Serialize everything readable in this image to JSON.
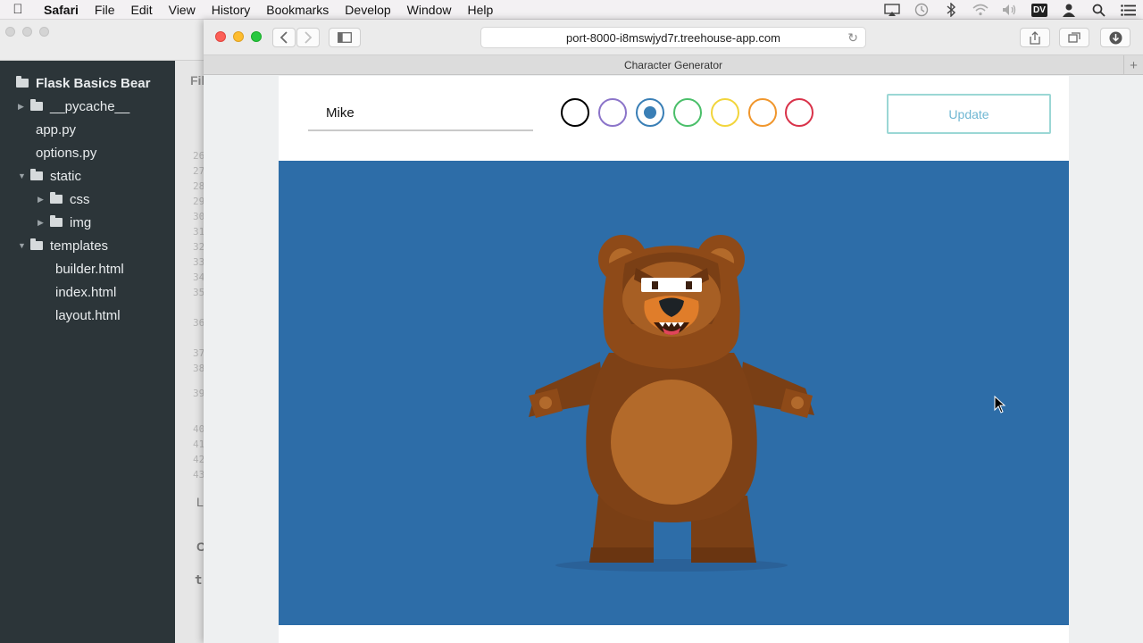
{
  "menubar": {
    "app": "Safari",
    "items": [
      "File",
      "Edit",
      "View",
      "History",
      "Bookmarks",
      "Develop",
      "Window",
      "Help"
    ],
    "status_badge": "DV"
  },
  "sidebar": {
    "project": "Flask Basics Bear",
    "items": [
      {
        "label": "__pycache__",
        "type": "folder"
      },
      {
        "label": "app.py",
        "type": "file"
      },
      {
        "label": "options.py",
        "type": "file"
      },
      {
        "label": "static",
        "type": "folder"
      },
      {
        "label": "css",
        "type": "folder"
      },
      {
        "label": "img",
        "type": "folder"
      },
      {
        "label": "templates",
        "type": "folder"
      },
      {
        "label": "builder.html",
        "type": "file"
      },
      {
        "label": "index.html",
        "type": "file"
      },
      {
        "label": "layout.html",
        "type": "file"
      }
    ]
  },
  "gutter": {
    "peeks": [
      "Fil",
      "L",
      "C",
      "tr"
    ],
    "line_numbers": [
      "26",
      "27",
      "28",
      "29",
      "30",
      "31",
      "32",
      "33",
      "34",
      "35",
      "36",
      "37",
      "38",
      "39",
      "40",
      "41",
      "42",
      "43"
    ]
  },
  "browser": {
    "url": "port-8000-i8mswjyd7r.treehouse-app.com",
    "tab_title": "Character Generator"
  },
  "page": {
    "name_value": "Mike",
    "update_label": "Update",
    "colors": [
      {
        "name": "black",
        "hex": "#000000",
        "selected": false
      },
      {
        "name": "purple",
        "hex": "#8b74c9",
        "selected": false
      },
      {
        "name": "blue",
        "hex": "#3a7fb6",
        "selected": true
      },
      {
        "name": "green",
        "hex": "#4bbf6a",
        "selected": false
      },
      {
        "name": "yellow",
        "hex": "#f2d53c",
        "selected": false
      },
      {
        "name": "orange",
        "hex": "#f0962c",
        "selected": false
      },
      {
        "name": "red",
        "hex": "#d9334a",
        "selected": false
      }
    ],
    "stage_color": "#2d6da8"
  }
}
